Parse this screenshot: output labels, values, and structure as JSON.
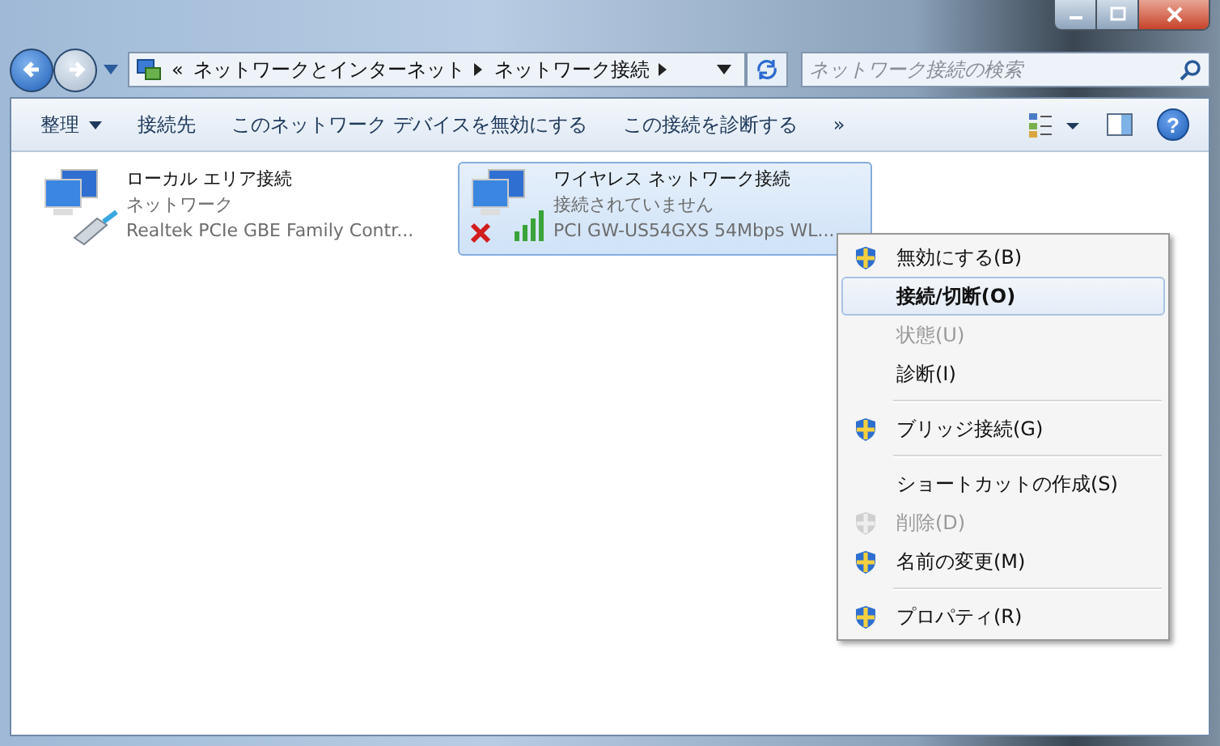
{
  "address_bar": {
    "overflow": "«",
    "crumbs": [
      "ネットワークとインターネット",
      "ネットワーク接続"
    ]
  },
  "search": {
    "placeholder": "ネットワーク接続の検索"
  },
  "toolbar": {
    "items": [
      {
        "label": "整理",
        "dropdown": true
      },
      {
        "label": "接続先",
        "dropdown": false
      },
      {
        "label": "このネットワーク デバイスを無効にする",
        "dropdown": false
      },
      {
        "label": "この接続を診断する",
        "dropdown": false
      }
    ],
    "more": "»",
    "help": "?"
  },
  "connections": [
    {
      "name": "ローカル エリア接続",
      "status": "ネットワーク",
      "adapter": "Realtek PCIe GBE Family Contr...",
      "kind": "wired",
      "disconnected": false,
      "selected": false
    },
    {
      "name": "ワイヤレス ネットワーク接続",
      "status": "接続されていません",
      "adapter": "PCI GW-US54GXS 54Mbps WL...",
      "kind": "wireless",
      "disconnected": true,
      "selected": true
    }
  ],
  "context_menu": [
    {
      "kind": "item",
      "label": "無効にする(B)",
      "shield": true,
      "disabled": false,
      "bold": false,
      "selected": false
    },
    {
      "kind": "item",
      "label": "接続/切断(O)",
      "shield": false,
      "disabled": false,
      "bold": true,
      "selected": true
    },
    {
      "kind": "item",
      "label": "状態(U)",
      "shield": false,
      "disabled": true,
      "bold": false,
      "selected": false
    },
    {
      "kind": "item",
      "label": "診断(I)",
      "shield": false,
      "disabled": false,
      "bold": false,
      "selected": false
    },
    {
      "kind": "separator"
    },
    {
      "kind": "item",
      "label": "ブリッジ接続(G)",
      "shield": true,
      "disabled": false,
      "bold": false,
      "selected": false
    },
    {
      "kind": "separator"
    },
    {
      "kind": "item",
      "label": "ショートカットの作成(S)",
      "shield": false,
      "disabled": false,
      "bold": false,
      "selected": false
    },
    {
      "kind": "item",
      "label": "削除(D)",
      "shield": true,
      "disabled": true,
      "bold": false,
      "selected": false
    },
    {
      "kind": "item",
      "label": "名前の変更(M)",
      "shield": true,
      "disabled": false,
      "bold": false,
      "selected": false
    },
    {
      "kind": "separator"
    },
    {
      "kind": "item",
      "label": "プロパティ(R)",
      "shield": true,
      "disabled": false,
      "bold": false,
      "selected": false
    }
  ]
}
